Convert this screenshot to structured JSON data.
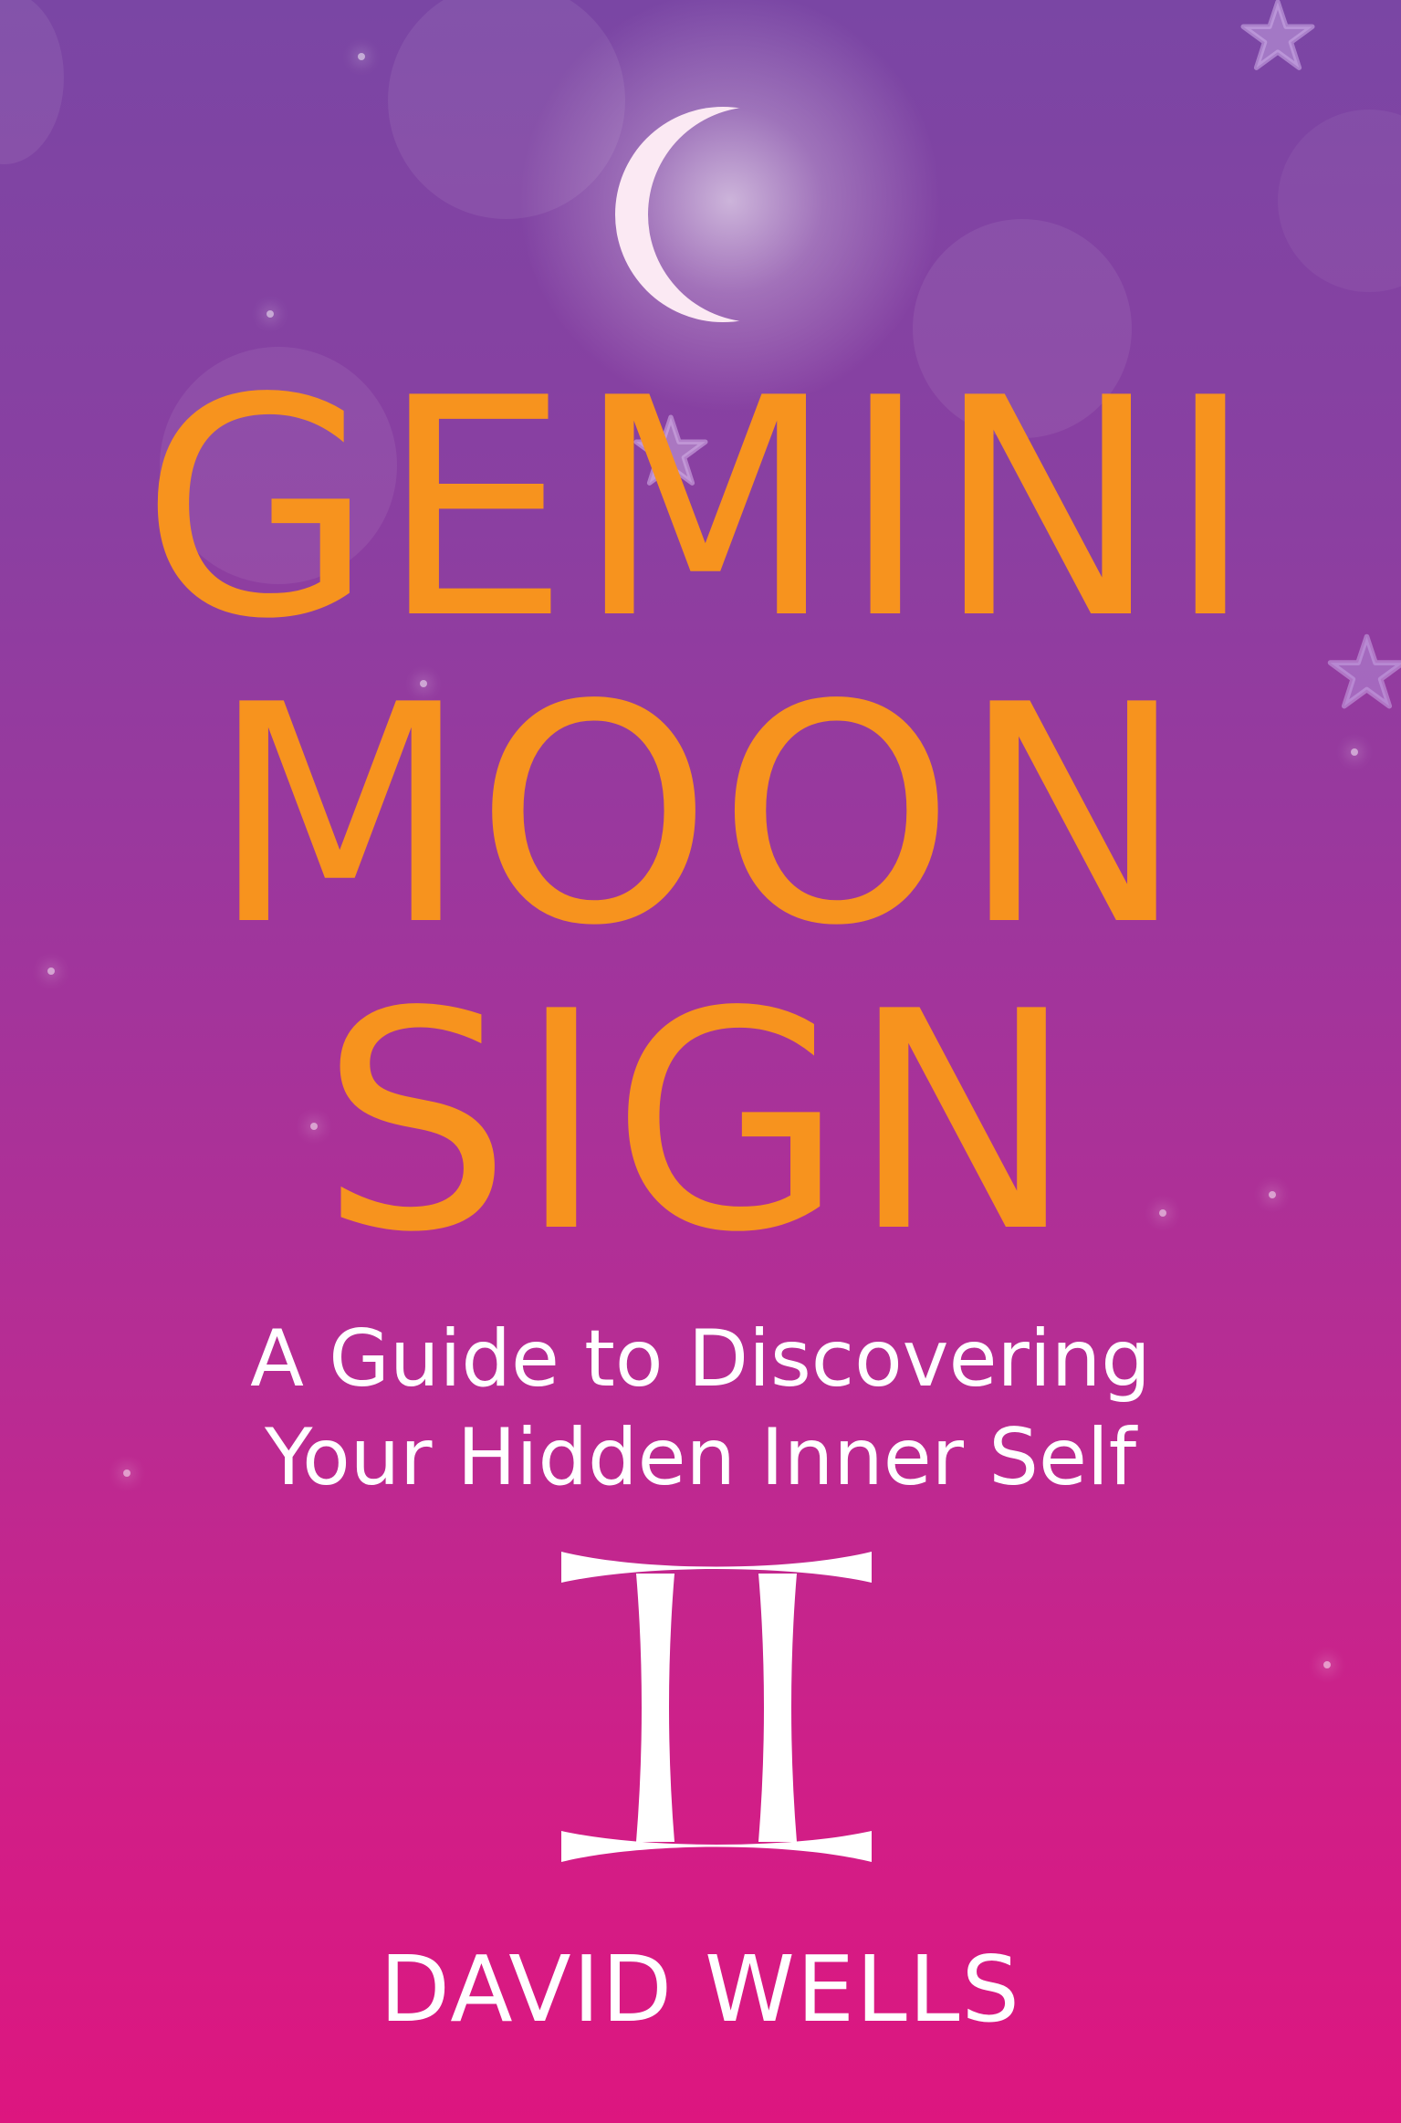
{
  "cover": {
    "title_lines": [
      "GEMINI",
      "MOON",
      "SIGN"
    ],
    "subtitle_lines": [
      "A Guide to Discovering",
      "Your Hidden Inner Self"
    ],
    "author": "DAVID WELLS"
  },
  "icons": {
    "moon": "crescent-moon-icon",
    "zodiac": "gemini-symbol-icon",
    "stars": "star-icon"
  },
  "colors": {
    "background_top": "#7a46a4",
    "background_bottom": "#dd167f",
    "title": "#f7931e",
    "text": "#ffffff"
  }
}
